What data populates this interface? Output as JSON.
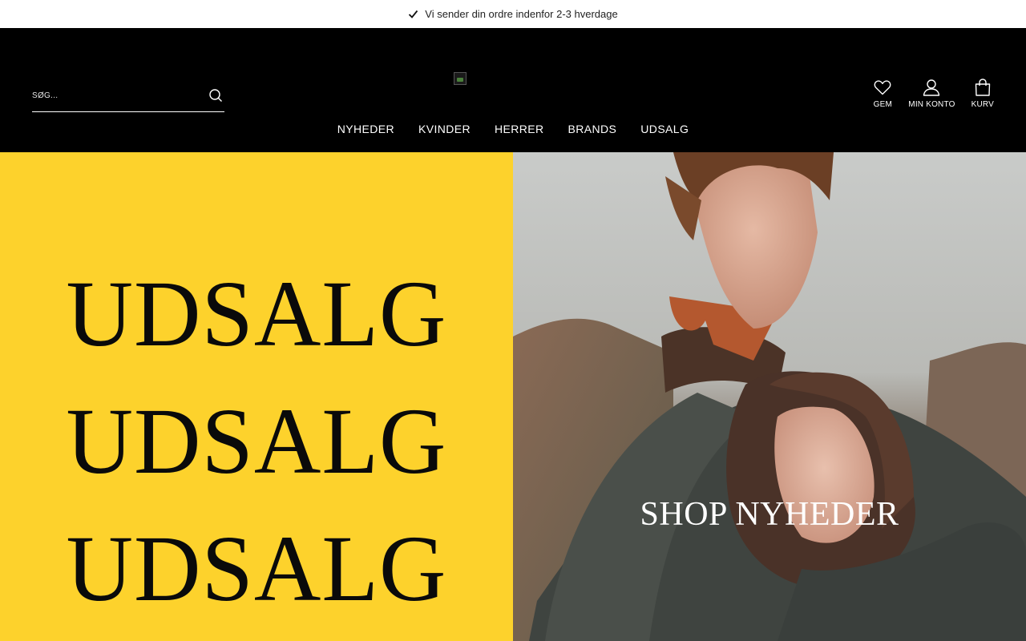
{
  "topbar": {
    "text": "Vi sender din ordre indenfor 2-3 hverdage",
    "icon": "checkmark-icon"
  },
  "header": {
    "search": {
      "placeholder": "SØG..."
    },
    "actions": [
      {
        "label": "GEM",
        "icon": "heart-icon"
      },
      {
        "label": "MIN KONTO",
        "icon": "user-icon"
      },
      {
        "label": "KURV",
        "icon": "bag-icon"
      }
    ],
    "nav": [
      "NYHEDER",
      "KVINDER",
      "HERRER",
      "BRANDS",
      "UDSALG"
    ]
  },
  "hero": {
    "left": {
      "lines": [
        "UDSALG",
        "UDSALG",
        "UDSALG"
      ],
      "background": "#fdd22c"
    },
    "right": {
      "label": "SHOP NYHEDER"
    }
  },
  "colors": {
    "header_bg": "#000000",
    "sale_yellow": "#fdd22c",
    "text_light": "#ffffff"
  }
}
